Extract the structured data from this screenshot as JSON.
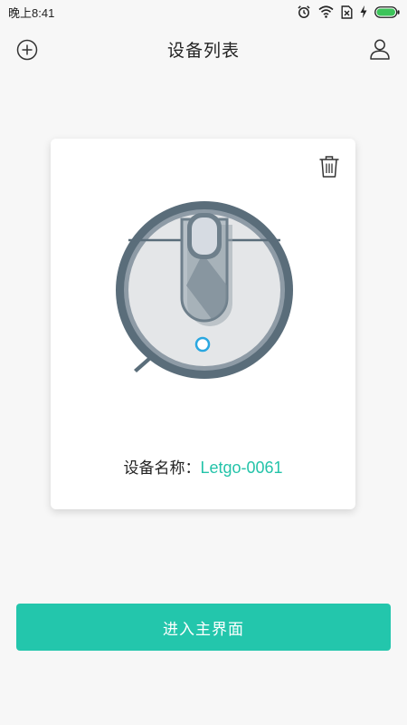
{
  "status_bar": {
    "time": "晚上8:41",
    "icons": [
      "alarm-icon",
      "wifi-icon",
      "no-sim-icon",
      "charging-icon",
      "battery-icon"
    ]
  },
  "header": {
    "title": "设备列表",
    "left_icon": "add-circle-icon",
    "right_icon": "user-icon"
  },
  "device_card": {
    "name_label": "设备名称：",
    "name_value": "Letgo-0061",
    "delete_icon": "trash-icon"
  },
  "enter_button": {
    "label": "进入主界面"
  },
  "colors": {
    "accent": "#23c6ac",
    "device_name": "#23c3a9",
    "background": "#f7f7f7",
    "card": "#ffffff",
    "battery": "#3cc45a"
  }
}
